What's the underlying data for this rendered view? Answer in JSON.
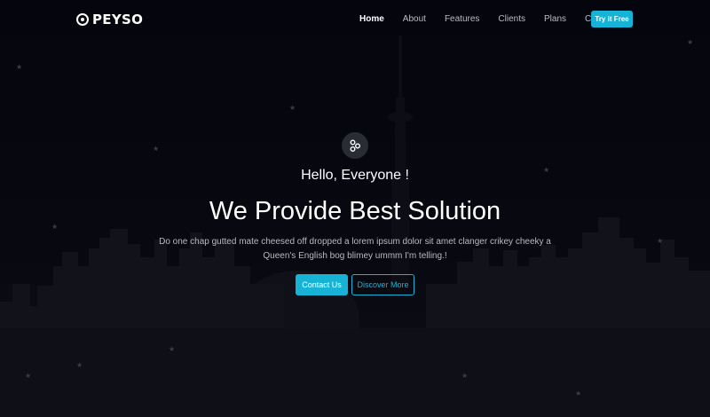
{
  "brand": {
    "name": "PEYSO",
    "logo_icon": "peyso-logo-icon"
  },
  "nav": {
    "items": [
      {
        "label": "Home",
        "active": true
      },
      {
        "label": "About",
        "active": false
      },
      {
        "label": "Features",
        "active": false
      },
      {
        "label": "Clients",
        "active": false
      },
      {
        "label": "Plans",
        "active": false
      },
      {
        "label": "Contact",
        "active": false
      }
    ],
    "cta_label": "Try it Free"
  },
  "hero": {
    "icon": "share-nodes-icon",
    "greeting": "Hello, Everyone !",
    "headline": "We Provide Best Solution",
    "description": "Do one chap gutted mate cheesed off dropped a lorem ipsum dolor sit amet clanger crikey cheeky a Queen's English bog blimey ummm I'm telling.!",
    "primary_button": "Contact Us",
    "secondary_button": "Discover More"
  },
  "colors": {
    "accent": "#16b3d6",
    "background": "#080811",
    "text": "#ffffff",
    "muted_text": "#b6b9c4"
  }
}
